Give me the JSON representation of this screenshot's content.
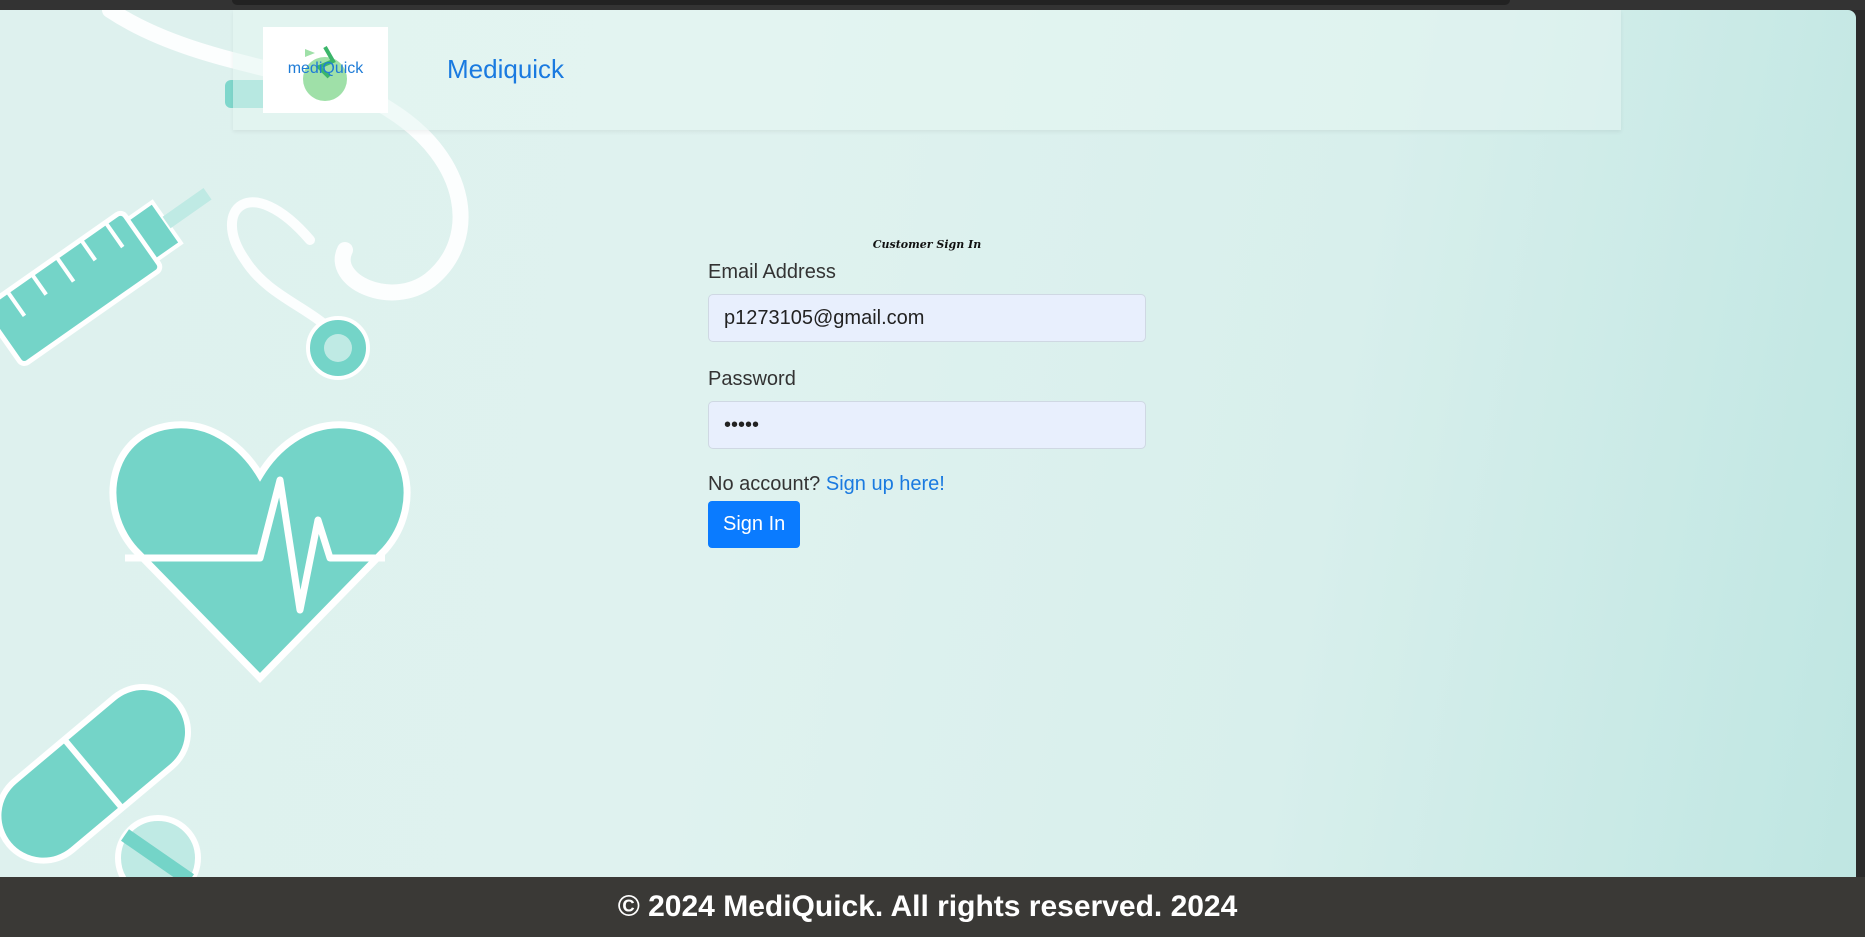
{
  "navbar": {
    "logo_text": "mediQuick",
    "brand": "Mediquick"
  },
  "form": {
    "title": "Customer Sign In",
    "email_label": "Email Address",
    "email_value": "p1273105@gmail.com",
    "password_label": "Password",
    "password_value": "•••••",
    "signup_prompt": "No account?",
    "signup_link": "Sign up here!",
    "submit_label": "Sign In"
  },
  "footer": {
    "text": "© 2024 MediQuick. All rights reserved. 2024"
  },
  "colors": {
    "accent": "#0a7bff",
    "link": "#1a7ae0",
    "footer_bg": "#3a3936",
    "decor_teal": "#74d4c8"
  }
}
